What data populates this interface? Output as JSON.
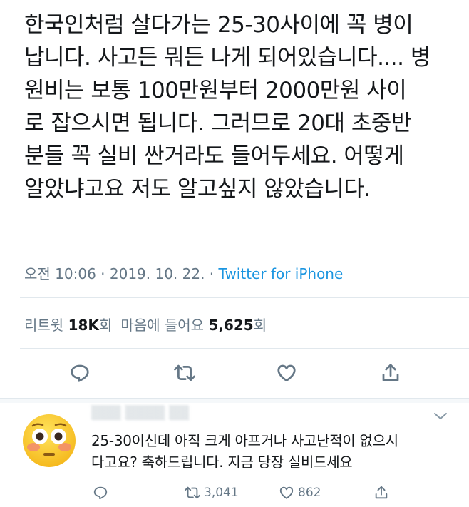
{
  "tweet": {
    "lines": [
      "한국인처럼 살다가는 25-30사이에 꼭 병이",
      "납니다. 사고든 뭐든 나게 되어있습니다.... 병",
      "원비는 보통 100만원부터 2000만원 사이",
      "로 잡으시면 됩니다. 그러므로 20대 초중반",
      "분들 꼭 실비 싼거라도 들어두세요. 어떻게",
      "알았냐고요 저도 알고싶지 않았습니다."
    ],
    "timestamp": "오전 10:06 · 2019. 10. 22. · ",
    "source": "Twitter for iPhone"
  },
  "stats": {
    "retweets_label": "리트윗 ",
    "retweets_count": "18K",
    "retweets_suffix": "회",
    "likes_label": "마음에 들어요 ",
    "likes_count": "5,625",
    "likes_suffix": "회"
  },
  "actions": {
    "icons": [
      "reply-icon",
      "retweet-icon",
      "like-icon",
      "share-icon"
    ]
  },
  "reply": {
    "avatar_emoji": "flushed-face",
    "lines": [
      "25-30이신데 아직 크게 아프거나 사고난적이 없으시",
      "다고요? 축하드립니다. 지금 당장 실비드세요"
    ],
    "retweet_count": "3,041",
    "like_count": "862"
  },
  "colors": {
    "text": "#14171a",
    "secondary": "#657786",
    "link": "#1b95e0",
    "divider": "#e1e8ed"
  }
}
